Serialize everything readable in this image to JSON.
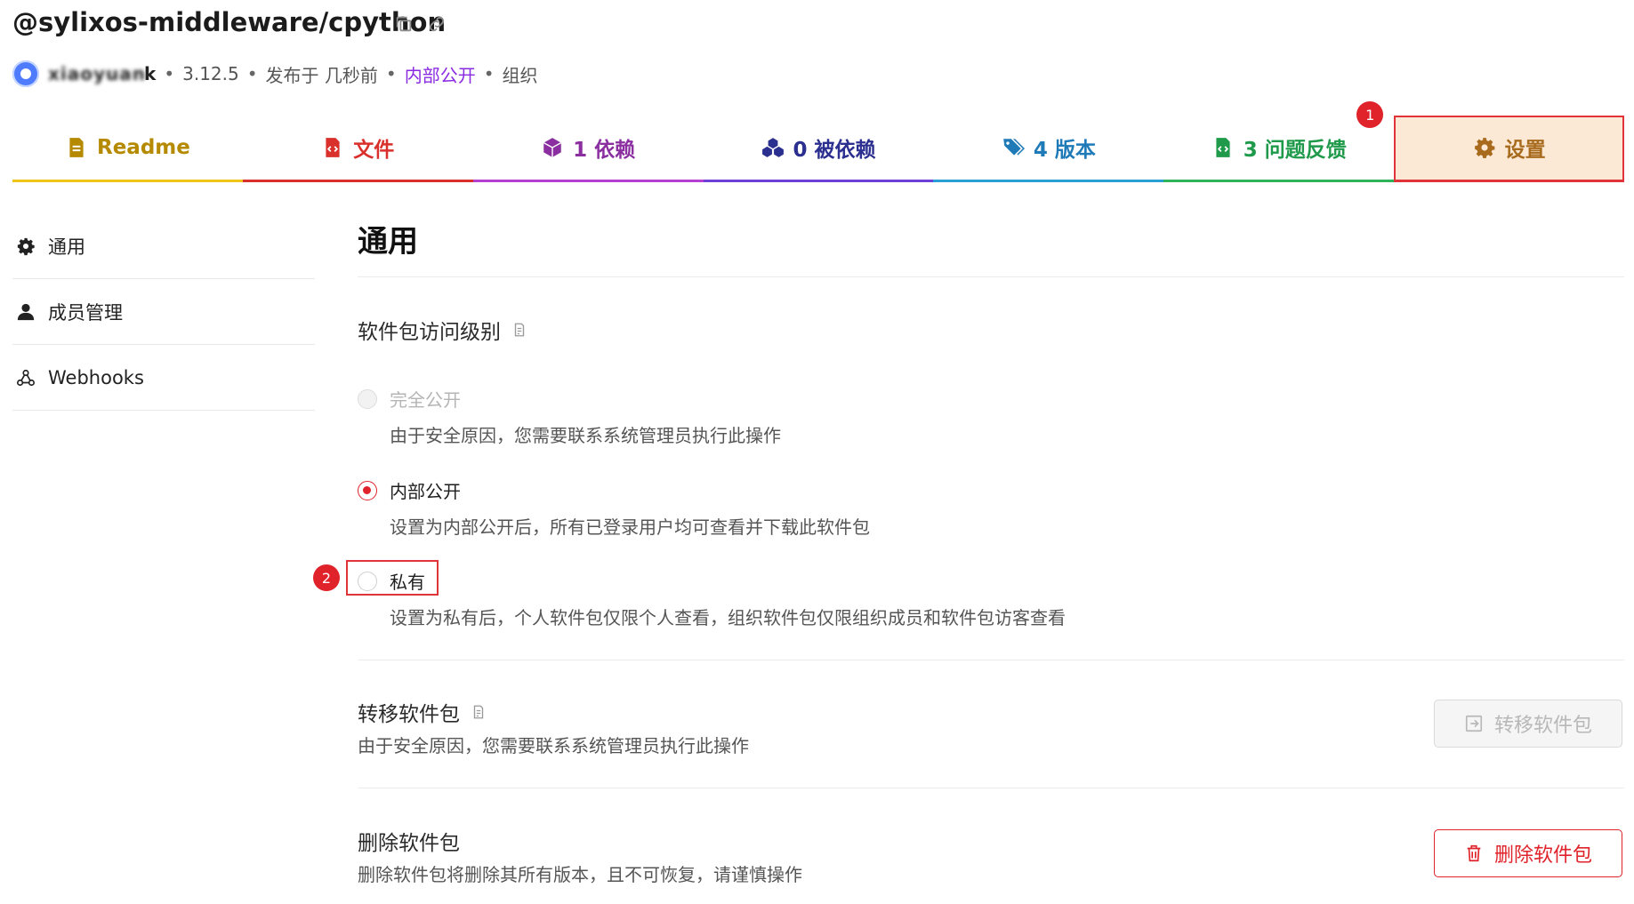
{
  "header": {
    "title": "@sylixos-middleware/cpython",
    "username_blur": "xiaoyuan",
    "username_tail": "k",
    "version": "3.12.5",
    "published": "发布于 几秒前",
    "visibility": "内部公开",
    "owner_type": "组织",
    "separator": "•"
  },
  "tabs": [
    {
      "label": "Readme",
      "color": "#b58a00",
      "icon": "document-icon"
    },
    {
      "label": "文件",
      "color": "#d9302c",
      "icon": "code-file-icon"
    },
    {
      "label": "1 依赖",
      "color": "#8a2ea0",
      "icon": "cube-icon"
    },
    {
      "label": "0 被依赖",
      "color": "#2b2f8f",
      "icon": "cubes-icon"
    },
    {
      "label": "4 版本",
      "color": "#1f7ab8",
      "icon": "tags-icon"
    },
    {
      "label": "3 问题反馈",
      "color": "#1f9a4a",
      "icon": "code-file-icon",
      "badge": "1"
    },
    {
      "label": "设置",
      "color": "#a86b1d",
      "icon": "gear-icon"
    }
  ],
  "sidebar": {
    "items": [
      {
        "label": "通用",
        "icon": "gear-icon"
      },
      {
        "label": "成员管理",
        "icon": "user-icon"
      },
      {
        "label": "Webhooks",
        "icon": "webhook-icon"
      }
    ]
  },
  "main": {
    "title": "通用",
    "access": {
      "title": "软件包访问级别",
      "options": [
        {
          "label": "完全公开",
          "desc": "由于安全原因，您需要联系系统管理员执行此操作",
          "state": "disabled"
        },
        {
          "label": "内部公开",
          "desc": "设置为内部公开后，所有已登录用户均可查看并下载此软件包",
          "state": "checked"
        },
        {
          "label": "私有",
          "desc": "设置为私有后，个人软件包仅限个人查看，组织软件包仅限组织成员和软件包访客查看",
          "state": "unchecked",
          "badge": "2"
        }
      ]
    },
    "transfer": {
      "title": "转移软件包",
      "desc": "由于安全原因，您需要联系系统管理员执行此操作",
      "button": "转移软件包"
    },
    "delete": {
      "title": "删除软件包",
      "desc": "删除软件包将删除其所有版本，且不可恢复，请谨慎操作",
      "button": "删除软件包"
    }
  },
  "colors": {
    "accent_red": "#e0222a",
    "active_tab_bg": "#fbe9d5",
    "visibility_purple": "#8a2be2"
  }
}
